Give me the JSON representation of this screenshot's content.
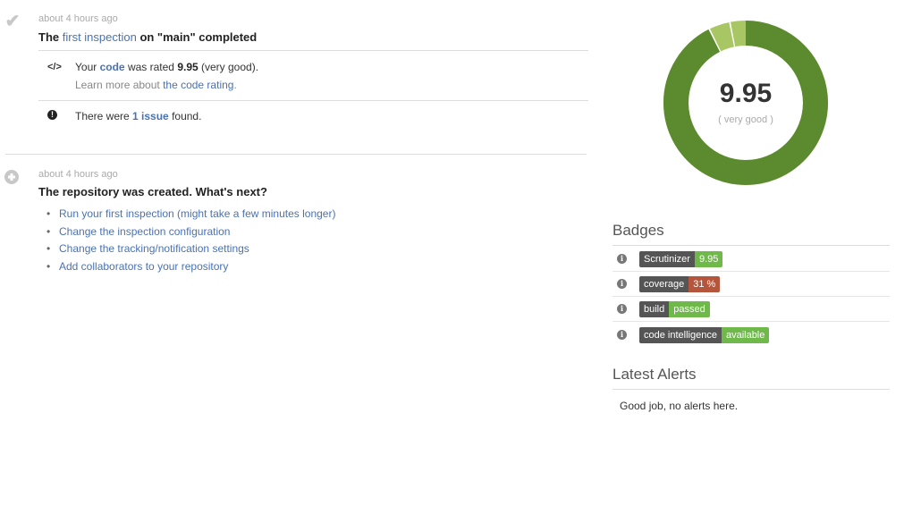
{
  "events": {
    "inspection": {
      "time": "about 4 hours ago",
      "title_prefix": "The ",
      "title_link": "first inspection",
      "title_suffix": " on \"main\" completed",
      "rating": {
        "icon": "code-icon",
        "text_prefix": "Your ",
        "code_link": "code",
        "text_mid": " was rated ",
        "score": "9.95",
        "text_suffix": " (very good).",
        "learn_prefix": "Learn more about ",
        "learn_link": "the code rating",
        "learn_suffix": "."
      },
      "issues": {
        "icon": "exclamation-icon",
        "text_prefix": "There were ",
        "issues_link": "1 issue",
        "text_suffix": " found."
      }
    },
    "created": {
      "time": "about 4 hours ago",
      "title": "The repository was created. What's next?",
      "next_steps": [
        "Run your first inspection (might take a few minutes longer)",
        "Change the inspection configuration",
        "Change the tracking/notification settings",
        "Add collaborators to your repository"
      ]
    }
  },
  "score": {
    "value": "9.95",
    "label": "( very good )",
    "fraction": 0.995,
    "color_main": "#5b8a2f",
    "color_rest": "#a8c764"
  },
  "badges": {
    "heading": "Badges",
    "items": [
      {
        "key": "Scrutinizer",
        "value": "9.95",
        "color": "#6fb84a"
      },
      {
        "key": "coverage",
        "value": "31 %",
        "color": "#b5563c"
      },
      {
        "key": "build",
        "value": "passed",
        "color": "#6fb84a"
      },
      {
        "key": "code intelligence",
        "value": "available",
        "color": "#6fb84a"
      }
    ]
  },
  "alerts": {
    "heading": "Latest Alerts",
    "text": "Good job, no alerts here."
  }
}
